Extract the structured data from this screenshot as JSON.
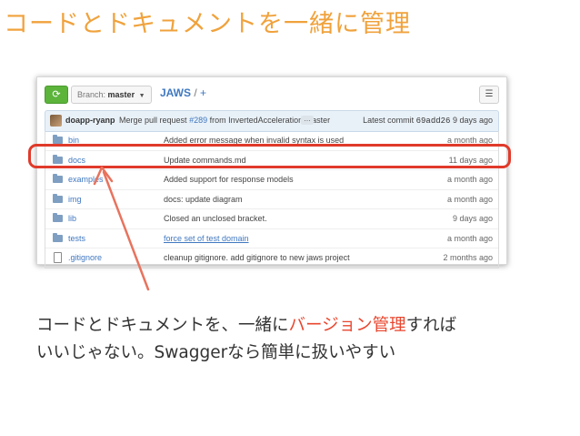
{
  "slide": {
    "title": "コードとドキュメントを一緒に管理",
    "caption_line1_a": "コードとドキュメントを、一緒に",
    "caption_line1_highlight": "バージョン管理",
    "caption_line1_b": "すれば",
    "caption_line2": "いいじゃない。Swaggerなら簡単に扱いやすい"
  },
  "repo": {
    "branch_label": "Branch:",
    "branch_name": "master",
    "name": "JAWS",
    "path_sep": "/",
    "add": "+"
  },
  "commit": {
    "author": "doapp-ryanp",
    "message_prefix": "Merge pull request",
    "pr": "#289",
    "message_suffix": "from InvertedAcceleration/master",
    "ellipsis": "…",
    "latest_label": "Latest commit",
    "sha": "69add26",
    "age": "9 days ago"
  },
  "files": [
    {
      "name": "bin",
      "message": "Added error message when invalid syntax is used",
      "age": "a month ago",
      "type": "dir"
    },
    {
      "name": "docs",
      "message": "Update commands.md",
      "age": "11 days ago",
      "type": "dir"
    },
    {
      "name": "examples",
      "message": "Added support for response models",
      "age": "a month ago",
      "type": "dir"
    },
    {
      "name": "img",
      "message": "docs: update diagram",
      "age": "a month ago",
      "type": "dir"
    },
    {
      "name": "lib",
      "message": "Closed an unclosed bracket.",
      "age": "9 days ago",
      "type": "dir"
    },
    {
      "name": "tests",
      "message": "force set of test domain",
      "age": "a month ago",
      "type": "dir"
    },
    {
      "name": ".gitignore",
      "message": "cleanup gitignore. add gitignore to new jaws project",
      "age": "2 months ago",
      "type": "file"
    }
  ],
  "colors": {
    "title": "#f0a23c",
    "highlight": "#e03a2a",
    "accent_text": "#e8462e",
    "link": "#4078c0"
  },
  "icons": {
    "refresh": "refresh-icon",
    "list": "list-icon",
    "folder": "folder-icon",
    "file": "file-icon"
  }
}
